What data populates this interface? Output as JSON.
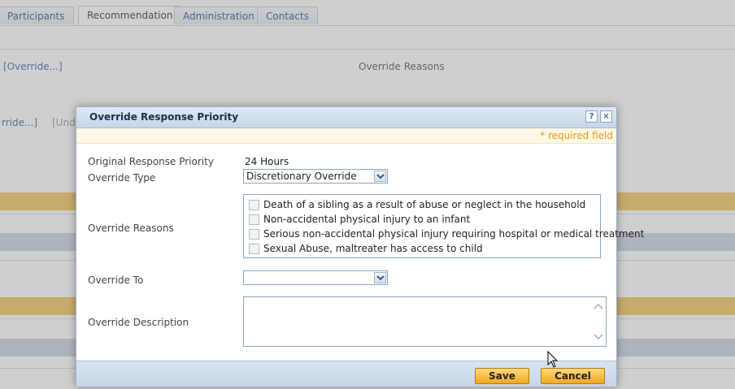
{
  "tabs": [
    {
      "label": "Participants"
    },
    {
      "label": "Recommendation"
    },
    {
      "label": "Administration"
    },
    {
      "label": "Contacts"
    }
  ],
  "background": {
    "override_link_1": "[Override...]",
    "override_reasons_header": "Override Reasons",
    "override_link_2": "rride...]",
    "undo_link": "[Undo"
  },
  "dialog": {
    "title": "Override Response Priority",
    "help_label": "?",
    "close_label": "×",
    "required_note": "* required field",
    "original_priority_label": "Original Response Priority",
    "original_priority_value": "24 Hours",
    "override_type_label": "Override Type",
    "override_type_value": "Discretionary Override",
    "override_reasons_label": "Override Reasons",
    "reasons": [
      {
        "label": "Death of a sibling as a result of abuse or neglect in the household",
        "checked": false
      },
      {
        "label": "Non-accidental physical injury to an infant",
        "checked": false
      },
      {
        "label": "Serious non-accidental physical injury requiring hospital or medical treatment",
        "checked": false
      },
      {
        "label": "Sexual Abuse, maltreater has access to child",
        "checked": false
      }
    ],
    "override_to_label": "Override To",
    "override_to_value": "",
    "override_description_label": "Override Description",
    "override_description_value": "",
    "save_label": "Save",
    "cancel_label": "Cancel"
  },
  "colors": {
    "accent_orange": "#f2a81f",
    "header_blue": "#c7d6e8",
    "required_orange": "#e39b16",
    "link_blue": "#2f6eaa"
  }
}
